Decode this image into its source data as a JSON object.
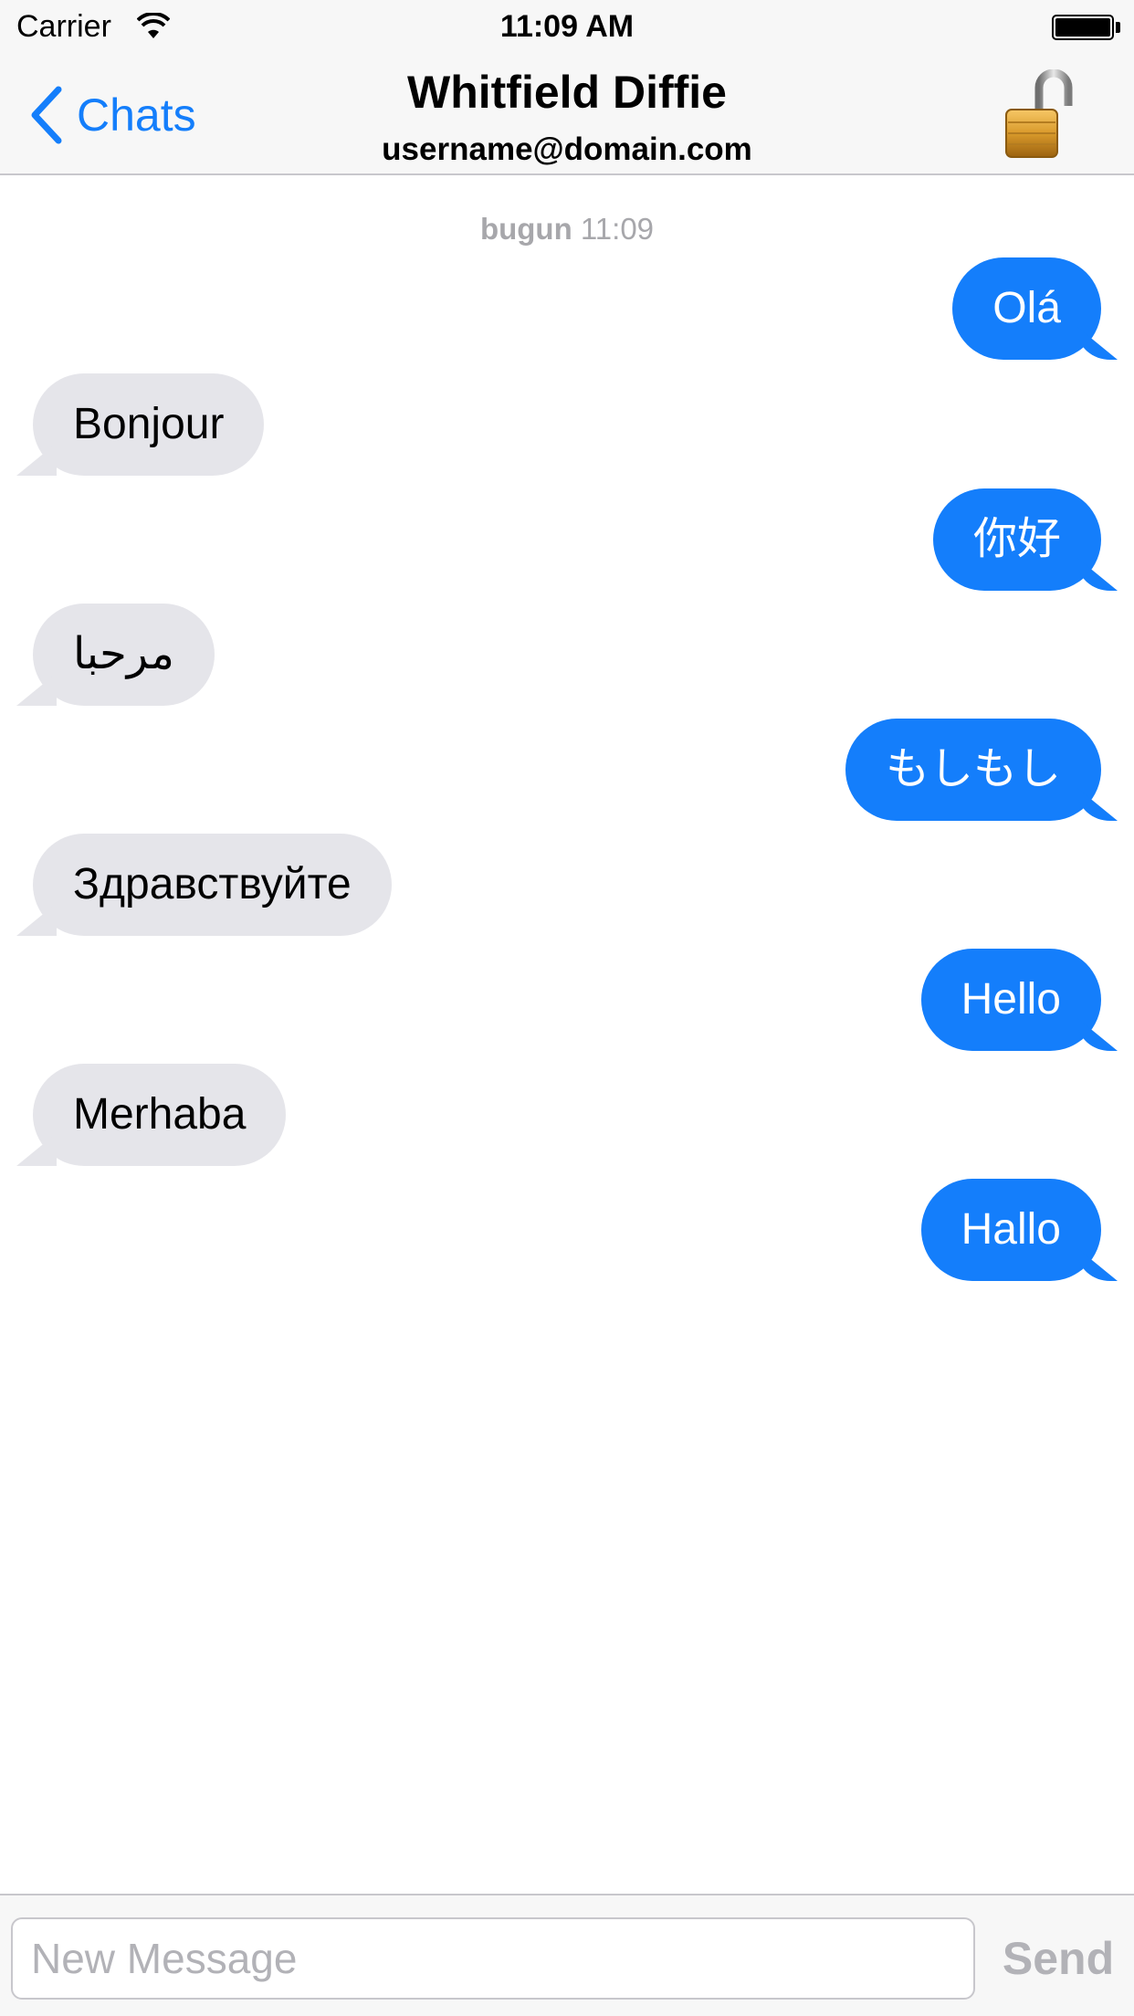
{
  "status_bar": {
    "carrier": "Carrier",
    "time": "11:09 AM",
    "battery_level": 1.0
  },
  "nav": {
    "back_label": "Chats",
    "title": "Whitfield Diffie",
    "subtitle": "username@domain.com",
    "lock_icon": "unlocked-padlock-icon"
  },
  "conversation": {
    "timestamp_day": "bugun",
    "timestamp_time": "11:09",
    "messages": [
      {
        "direction": "outgoing",
        "text": "Olá"
      },
      {
        "direction": "incoming",
        "text": "Bonjour"
      },
      {
        "direction": "outgoing",
        "text": "你好"
      },
      {
        "direction": "incoming",
        "text": "مرحبا"
      },
      {
        "direction": "outgoing",
        "text": "もしもし"
      },
      {
        "direction": "incoming",
        "text": "Здравствуйте"
      },
      {
        "direction": "outgoing",
        "text": "Hello"
      },
      {
        "direction": "incoming",
        "text": "Merhaba"
      },
      {
        "direction": "outgoing",
        "text": "Hallo"
      }
    ]
  },
  "input_bar": {
    "value": "",
    "placeholder": "New Message",
    "send_label": "Send"
  },
  "colors": {
    "accent": "#147efb",
    "outgoing_bubble": "#147efb",
    "incoming_bubble": "#e5e5ea",
    "disabled_text": "#b2b2b7"
  }
}
